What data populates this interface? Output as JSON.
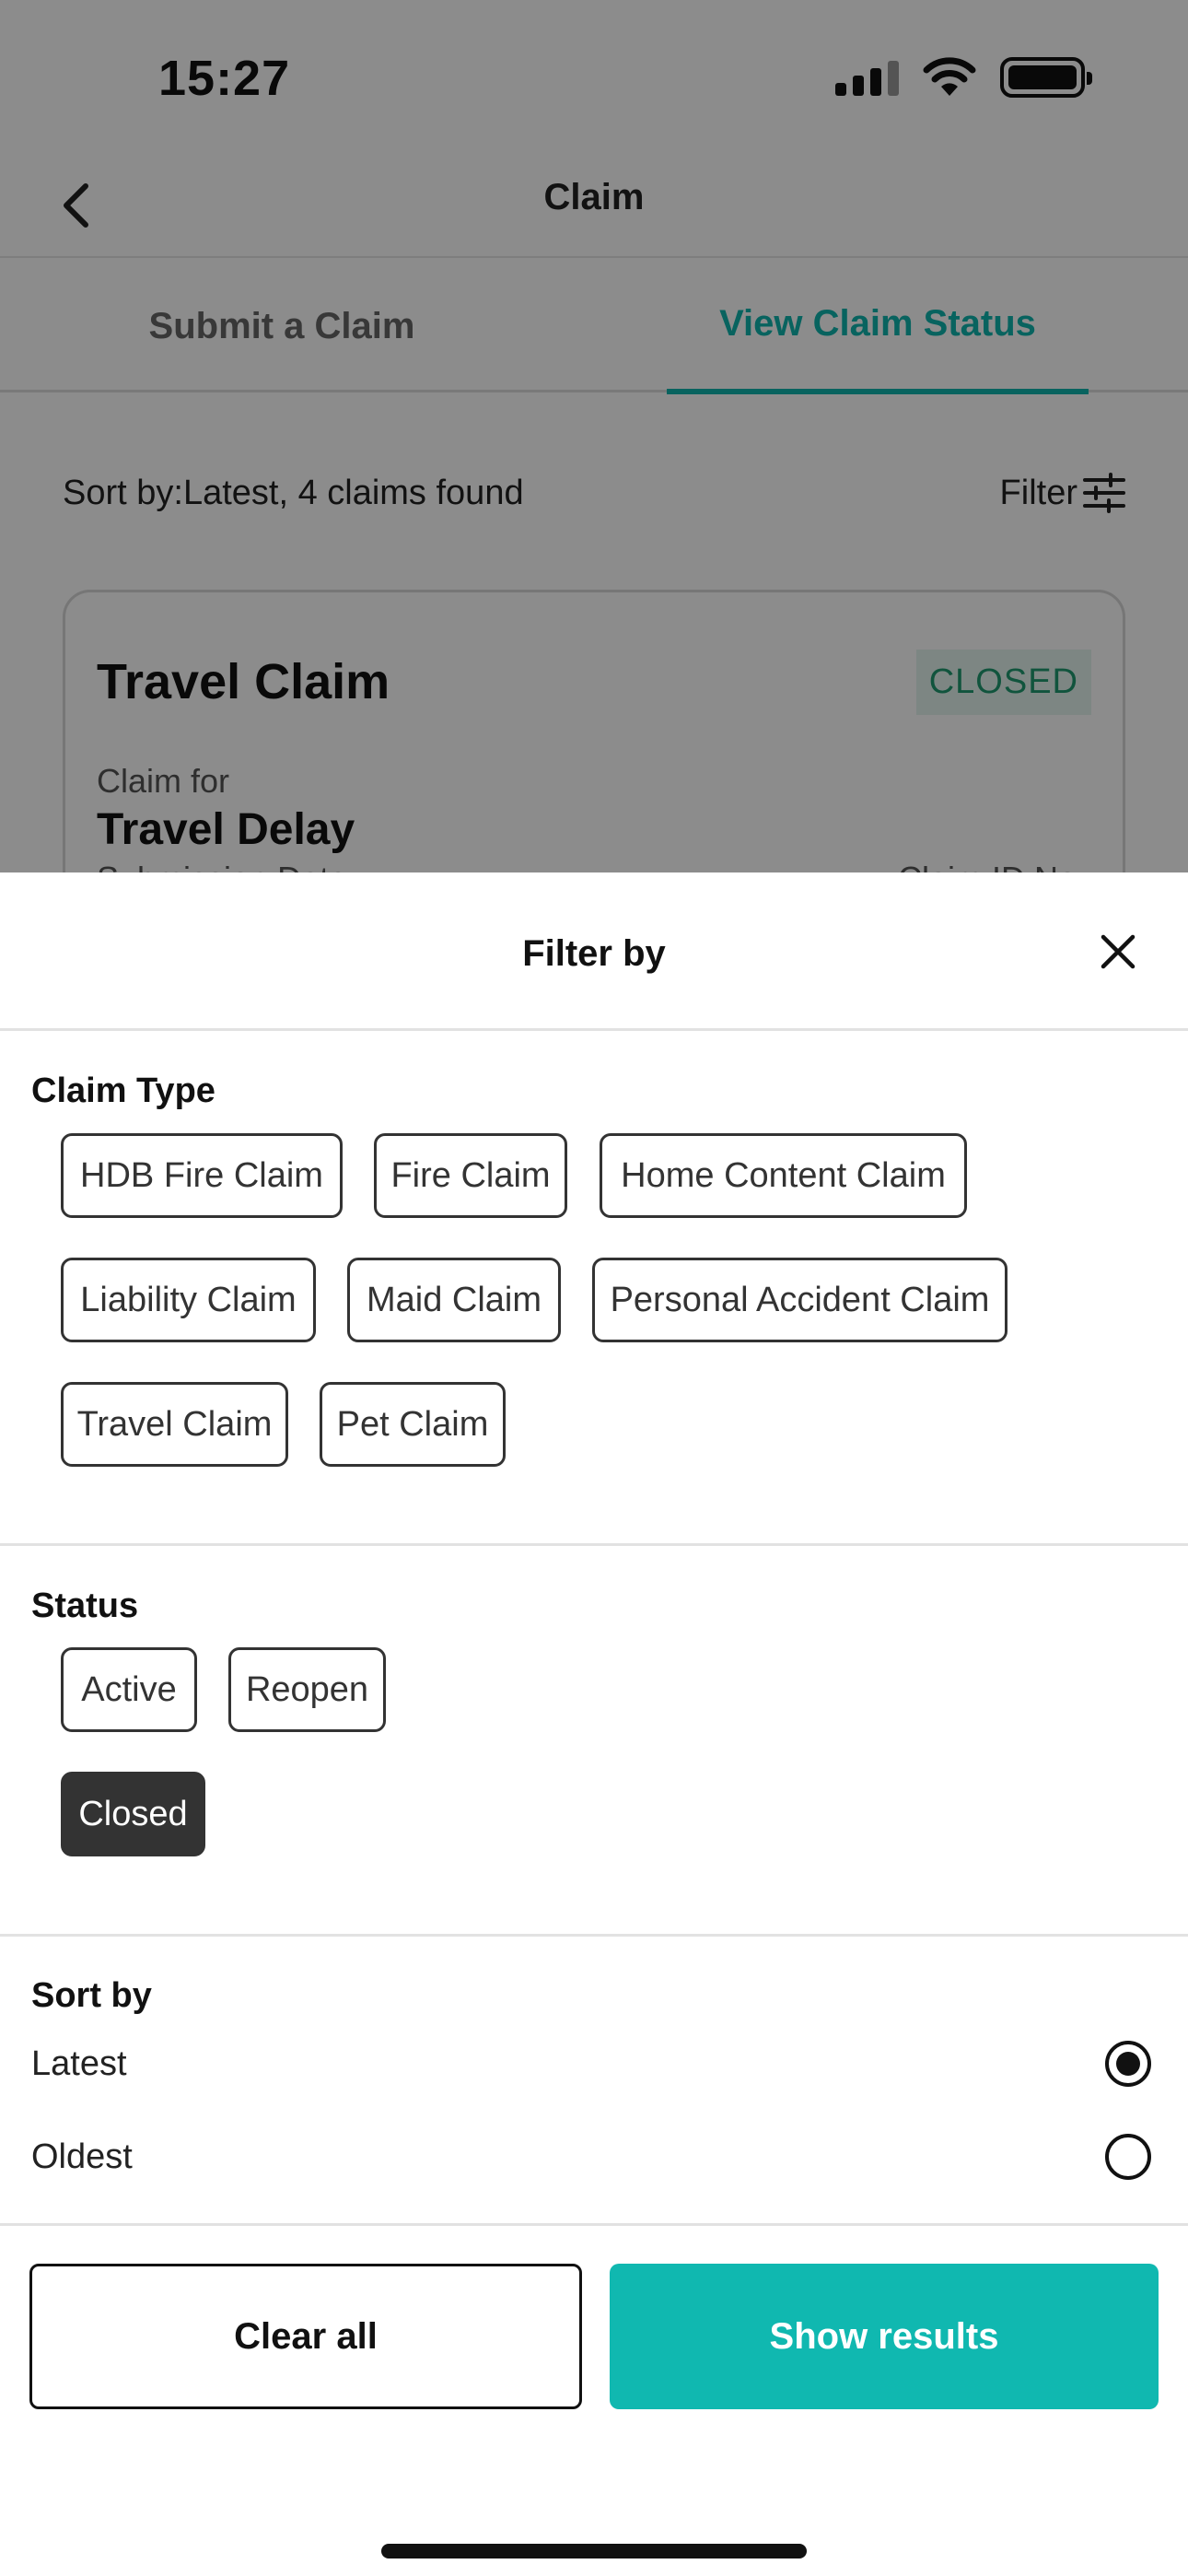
{
  "status_bar": {
    "time": "15:27"
  },
  "nav": {
    "title": "Claim"
  },
  "tabs": [
    {
      "label": "Submit a Claim"
    },
    {
      "label": "View Claim Status"
    }
  ],
  "list": {
    "sort_summary": "Sort by:Latest, 4 claims found",
    "filter_label": "Filter"
  },
  "claim_card": {
    "title": "Travel Claim",
    "status": "CLOSED",
    "claim_for_label": "Claim for",
    "claim_for_value": "Travel Delay",
    "submission_date_label": "Submission Date",
    "claim_id_label": "Claim ID No"
  },
  "sheet": {
    "title": "Filter by",
    "claim_type": {
      "title": "Claim Type",
      "options": [
        {
          "label": "HDB Fire Claim"
        },
        {
          "label": "Fire Claim"
        },
        {
          "label": "Home Content Claim"
        },
        {
          "label": "Liability Claim"
        },
        {
          "label": "Maid Claim"
        },
        {
          "label": "Personal Accident Claim"
        },
        {
          "label": "Travel Claim"
        },
        {
          "label": "Pet Claim"
        }
      ]
    },
    "status": {
      "title": "Status",
      "options": [
        {
          "label": "Active"
        },
        {
          "label": "Reopen"
        },
        {
          "label": "Closed",
          "selected": true
        }
      ]
    },
    "sort_by": {
      "title": "Sort by",
      "options": [
        {
          "label": "Latest",
          "selected": true
        },
        {
          "label": "Oldest",
          "selected": false
        }
      ]
    },
    "buttons": {
      "clear_all": "Clear all",
      "show_results": "Show results"
    }
  },
  "colors": {
    "accent": "#10b5ad",
    "button_primary": "#10b8b0",
    "selected_chip": "#333333",
    "closed_badge_text": "#1f9a6f",
    "closed_badge_bg": "#e4f4ef"
  }
}
